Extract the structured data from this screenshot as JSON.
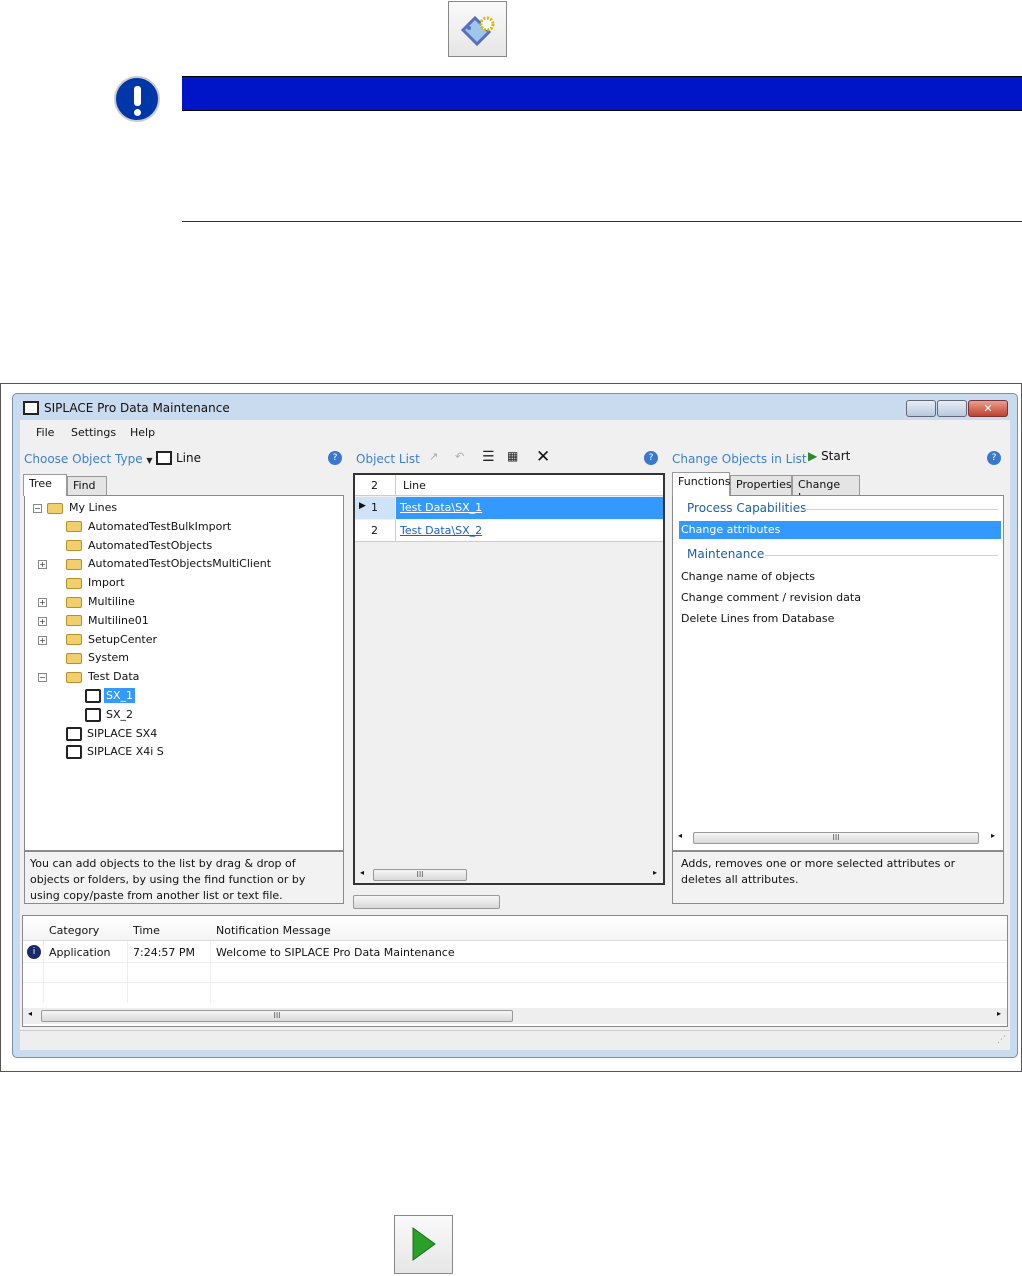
{
  "top_icon": "tag-gear-icon",
  "notice": {
    "icon": "exclamation-icon",
    "color": "#0014c8"
  },
  "window": {
    "title": "SIPLACE Pro Data Maintenance",
    "menu": [
      "File",
      "Settings",
      "Help"
    ],
    "left": {
      "choose_label": "Choose Object Type",
      "object_type": "Line",
      "tabs": [
        "Tree",
        "Find"
      ],
      "tree": [
        {
          "label": "My Lines",
          "type": "folder",
          "level": 0,
          "expander": "-"
        },
        {
          "label": "AutomatedTestBulkImport",
          "type": "folder",
          "level": 1,
          "expander": ""
        },
        {
          "label": "AutomatedTestObjects",
          "type": "folder",
          "level": 1,
          "expander": ""
        },
        {
          "label": "AutomatedTestObjectsMultiClient",
          "type": "folder",
          "level": 1,
          "expander": "+"
        },
        {
          "label": "Import",
          "type": "folder",
          "level": 1,
          "expander": ""
        },
        {
          "label": "Multiline",
          "type": "folder",
          "level": 1,
          "expander": "+"
        },
        {
          "label": "Multiline01",
          "type": "folder",
          "level": 1,
          "expander": "+"
        },
        {
          "label": "SetupCenter",
          "type": "folder",
          "level": 1,
          "expander": "+"
        },
        {
          "label": "System",
          "type": "folder",
          "level": 1,
          "expander": ""
        },
        {
          "label": "Test Data",
          "type": "folder",
          "level": 1,
          "expander": "-"
        },
        {
          "label": "SX_1",
          "type": "line",
          "level": 2,
          "expander": "",
          "selected": true
        },
        {
          "label": "SX_2",
          "type": "line",
          "level": 2,
          "expander": ""
        },
        {
          "label": "SIPLACE SX4",
          "type": "line",
          "level": 1,
          "expander": ""
        },
        {
          "label": "SIPLACE X4i S",
          "type": "line",
          "level": 1,
          "expander": ""
        }
      ],
      "hint": "You can add objects to the list by drag & drop of objects or folders, by using the find function or by using copy/paste from another list or text file."
    },
    "middle": {
      "title": "Object List",
      "count": "2",
      "column": "Line",
      "rows": [
        {
          "num": "1",
          "value": "Test Data\\SX_1",
          "selected": true
        },
        {
          "num": "2",
          "value": "Test Data\\SX_2"
        }
      ]
    },
    "right": {
      "title": "Change Objects in List",
      "start": "Start",
      "tabs": [
        "Functions",
        "Properties",
        "Change Log"
      ],
      "group1": "Process Capabilities",
      "item_selected": "Change attributes",
      "group2": "Maintenance",
      "items": [
        "Change name of objects",
        "Change comment / revision data",
        "Delete Lines from Database"
      ],
      "description": "Adds, removes one or more selected attributes or deletes all attributes."
    },
    "log": {
      "columns": [
        "Category",
        "Time",
        "Notification Message"
      ],
      "rows": [
        {
          "category": "Application",
          "time": "7:24:57 PM",
          "message": "Welcome to SIPLACE Pro Data Maintenance"
        }
      ]
    }
  },
  "bottom_icon": "play-icon"
}
